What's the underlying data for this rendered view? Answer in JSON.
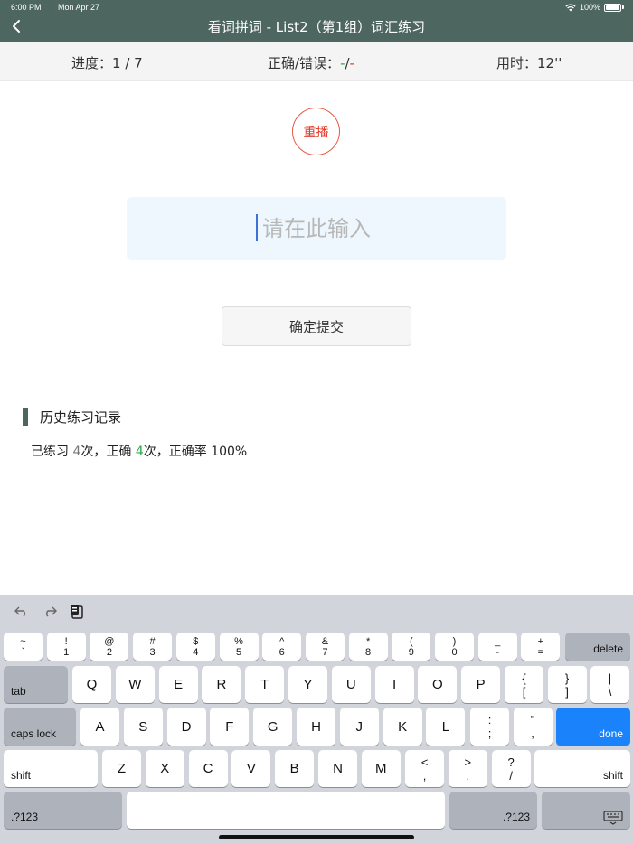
{
  "status": {
    "time": "6:00 PM",
    "date": "Mon Apr 27",
    "battery": "100%"
  },
  "nav": {
    "title": "看词拼词 - List2（第1组）词汇练习"
  },
  "stats": {
    "progress_label": "进度：",
    "progress_value": "1 / 7",
    "correct_label": "正确/错误：",
    "correct_value": "-",
    "slash": "/",
    "wrong_value": "-",
    "time_label": "用时：",
    "time_value": "12''"
  },
  "replay_label": "重播",
  "input": {
    "placeholder": "请在此输入",
    "value": ""
  },
  "submit_label": "确定提交",
  "history": {
    "title": "历史练习记录",
    "prefix": "已练习 ",
    "times": "4",
    "mid": "次，正确 ",
    "correct": "4",
    "rate_label": "次，正确率 ",
    "rate": "100%"
  },
  "keyboard": {
    "row1": [
      {
        "top": "~",
        "bottom": "`"
      },
      {
        "top": "!",
        "bottom": "1"
      },
      {
        "top": "@",
        "bottom": "2"
      },
      {
        "top": "#",
        "bottom": "3"
      },
      {
        "top": "$",
        "bottom": "4"
      },
      {
        "top": "%",
        "bottom": "5"
      },
      {
        "top": "^",
        "bottom": "6"
      },
      {
        "top": "&",
        "bottom": "7"
      },
      {
        "top": "*",
        "bottom": "8"
      },
      {
        "top": "(",
        "bottom": "9"
      },
      {
        "top": ")",
        "bottom": "0"
      },
      {
        "top": "_",
        "bottom": "-"
      },
      {
        "top": "+",
        "bottom": "="
      }
    ],
    "delete": "delete",
    "tab": "tab",
    "row2": [
      "Q",
      "W",
      "E",
      "R",
      "T",
      "Y",
      "U",
      "I",
      "O",
      "P"
    ],
    "row2_sym": [
      {
        "top": "{",
        "bottom": "["
      },
      {
        "top": "}",
        "bottom": "]"
      },
      {
        "top": "|",
        "bottom": "\\"
      }
    ],
    "caps": "caps lock",
    "row3": [
      "A",
      "S",
      "D",
      "F",
      "G",
      "H",
      "J",
      "K",
      "L"
    ],
    "row3_sym": [
      {
        "top": ":",
        "bottom": ";"
      },
      {
        "top": "\"",
        "bottom": ","
      }
    ],
    "done": "done",
    "shift": "shift",
    "row4": [
      "Z",
      "X",
      "C",
      "V",
      "B",
      "N",
      "M"
    ],
    "row4_sym": [
      {
        "top": "<",
        "bottom": ","
      },
      {
        "top": ">",
        "bottom": "."
      },
      {
        "top": "?",
        "bottom": "/"
      }
    ],
    "numbers": ".?123"
  },
  "colors": {
    "header": "#4d6660",
    "accent_red": "#e23b2e",
    "accent_green": "#2aa848",
    "keyboard_blue": "#1a82fb"
  }
}
